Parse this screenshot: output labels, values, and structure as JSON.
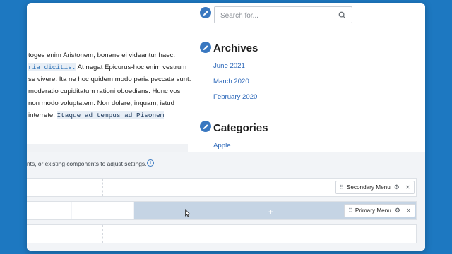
{
  "article": {
    "line1": "toges enim Aristonem, bonane ei videantur haec:",
    "line2_code": "ria dicitis.",
    "line2_text": " At negat Epicurus-hoc enim vestrum",
    "line3": "se vivere. Ita ne hoc quidem modo paria peccata sunt.",
    "line4": "moderatio cupiditatum rationi oboediens. Hunc vos",
    "line5": "non modo voluptatem. Non dolere, inquam, istud",
    "line6_text": "interrete. ",
    "line6_code": "Itaque ad tempus ad Pisonem"
  },
  "search": {
    "placeholder": "Search for...",
    "icon": "search-icon"
  },
  "archives": {
    "title": "Archives",
    "items": [
      "June 2021",
      "March 2020",
      "February 2020"
    ]
  },
  "categories": {
    "title": "Categories",
    "items": [
      "Apple"
    ]
  },
  "panel": {
    "hint": "nts, or existing components to adjust settings.",
    "secondary_menu_label": "Secondary Menu",
    "primary_menu_label": "Primary Menu",
    "plus": "+"
  },
  "colors": {
    "background": "#1d78c1",
    "accent": "#3a78c0",
    "link": "#2a66b8",
    "drop_zone": "#c5d4e4"
  }
}
